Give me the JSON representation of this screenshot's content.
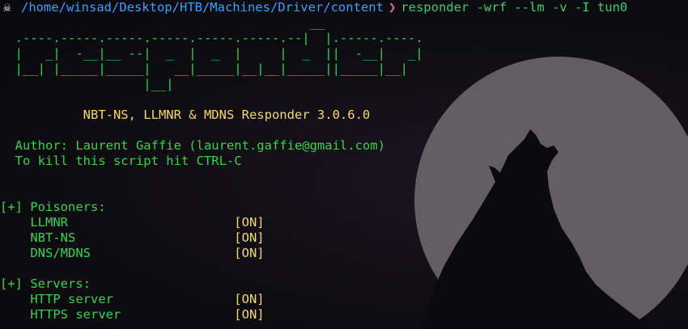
{
  "prompt": {
    "icon": "skull-icon",
    "path": "/home/winsad/Desktop/HTB/Machines/Driver/content",
    "separator": "❯",
    "command": "responder -wrf --lm -v -I tun0"
  },
  "banner_lines": [
    "                                         __",
    "  .----.-----.-----.-----.-----.-----.--|  |.-----.----.",
    "  |   _|  -__|__ --|  _  |  _  |     |  _  ||  -__|   _|",
    "  |__| |_____|_____|   __|_____|__|__|_____||_____|__|",
    "                   |__|"
  ],
  "tagline": "           NBT-NS, LLMNR & MDNS Responder 3.0.6.0",
  "author": "  Author: Laurent Gaffie (laurent.gaffie@gmail.com)",
  "kill_hint": "  To kill this script hit CTRL-C",
  "poisoners": {
    "header": "[+] Poisoners:",
    "items": [
      {
        "name": "    LLMNR                      ",
        "state": "[ON]"
      },
      {
        "name": "    NBT-NS                     ",
        "state": "[ON]"
      },
      {
        "name": "    DNS/MDNS                   ",
        "state": "[ON]"
      }
    ]
  },
  "servers": {
    "header": "[+] Servers:",
    "items": [
      {
        "name": "    HTTP server                ",
        "state": "[ON]"
      },
      {
        "name": "    HTTPS server               ",
        "state": "[ON]"
      }
    ]
  },
  "colors": {
    "path": "#3aa0ff",
    "command": "#42c96e",
    "banner": "#34d058",
    "tagline": "#f5d76e",
    "on_state": "#f5d76e",
    "moon": "#6e6a70"
  }
}
